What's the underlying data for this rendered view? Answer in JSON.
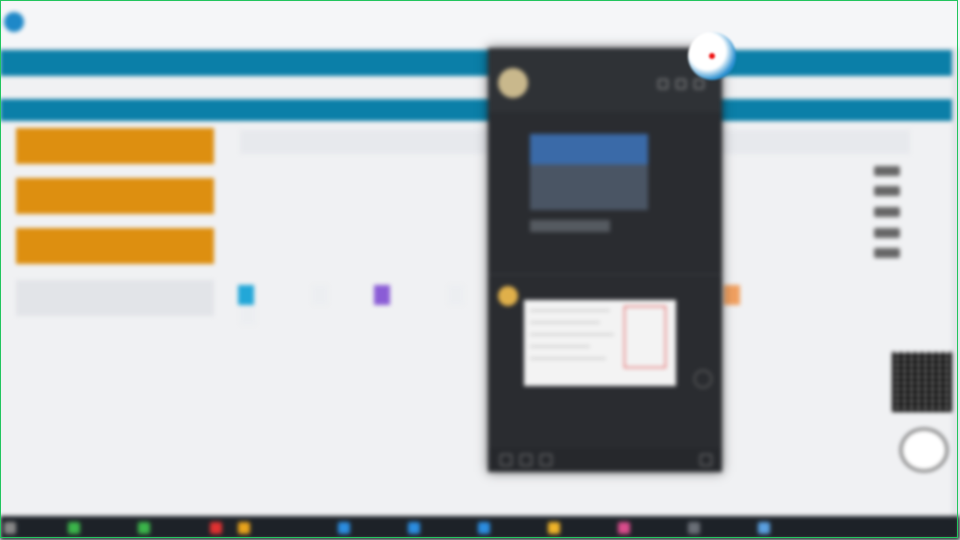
{
  "browser": {
    "address": "",
    "tab_title": "",
    "tab2": "",
    "mid": "",
    "right": ""
  },
  "nav": {
    "brand": "",
    "items": [
      "",
      "",
      ""
    ],
    "right1": "",
    "right2": ""
  },
  "marquee": "",
  "subnav": {
    "items": [
      "",
      "",
      "",
      "",
      "",
      "",
      ""
    ]
  },
  "sidebar": {
    "buttons": [
      "",
      "",
      ""
    ],
    "heading": "",
    "links": [
      "",
      "",
      "",
      "",
      "",
      "",
      "",
      "",
      "",
      "",
      "",
      "",
      ""
    ]
  },
  "notices": {
    "title": "",
    "rows": [
      {
        "date": "",
        "text": ""
      },
      {
        "date": "",
        "text": ""
      },
      {
        "date": "",
        "text": ""
      },
      {
        "date": "",
        "text": ""
      },
      {
        "date": "",
        "text": ""
      }
    ]
  },
  "tabs2": [
    "",
    "",
    "",
    "",
    "",
    ""
  ],
  "list2": [
    {
      "date": "",
      "text": ""
    },
    {
      "date": "",
      "text": ""
    },
    {
      "date": "",
      "text": ""
    },
    {
      "date": "",
      "text": ""
    },
    {
      "date": "",
      "text": ""
    },
    {
      "date": "",
      "text": ""
    },
    {
      "date": "",
      "text": ""
    },
    {
      "date": "",
      "text": ""
    },
    {
      "date": "",
      "text": ""
    },
    {
      "date": "",
      "text": ""
    }
  ],
  "qr_label": "",
  "chat": {
    "name": "",
    "notice": "",
    "bubble": "",
    "time": "",
    "sender": ""
  },
  "taskbar": {
    "items": [
      {
        "label": "",
        "color": "#3bb54a"
      },
      {
        "label": "",
        "color": "#3bb54a"
      },
      {
        "label": "",
        "color": "#e03131"
      },
      {
        "label": "",
        "color": "#e8a31c"
      },
      {
        "label": "",
        "color": "#2b8de0"
      },
      {
        "label": "",
        "color": "#2b8de0"
      },
      {
        "label": "",
        "color": "#2b8de0"
      },
      {
        "label": "",
        "color": "#f0b429"
      },
      {
        "label": "",
        "color": "#d94c8c"
      },
      {
        "label": "",
        "color": "#6a6f77"
      },
      {
        "label": "",
        "color": "#5aa0e0"
      }
    ]
  },
  "colors": {
    "nav": "#0b7fa8",
    "sidebar_button": "#dd8f10",
    "chat_bg": "#2a2c30",
    "frame": "#22c55e"
  }
}
